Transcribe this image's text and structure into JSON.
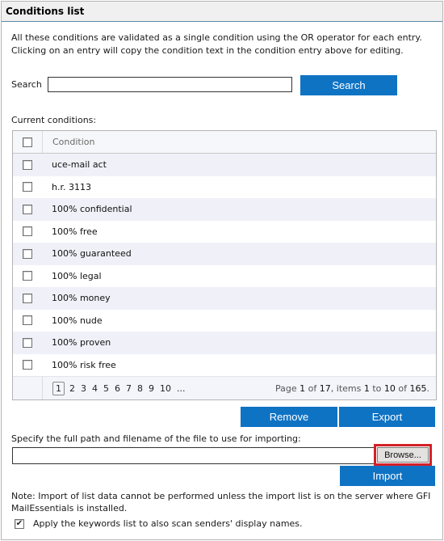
{
  "panel": {
    "title": "Conditions list",
    "intro_line1": "All these conditions are validated as a single condition using the OR operator for each entry.",
    "intro_line2": "Clicking on an entry will copy the condition text in the condition entry above for editing."
  },
  "search": {
    "label": "Search",
    "value": "",
    "placeholder": "",
    "button_label": "Search"
  },
  "conditions": {
    "label": "Current conditions:",
    "column_header": "Condition",
    "rows": [
      {
        "text": "uce-mail act",
        "checked": false
      },
      {
        "text": "h.r. 3113",
        "checked": false
      },
      {
        "text": "100% confidential",
        "checked": false
      },
      {
        "text": "100% free",
        "checked": false
      },
      {
        "text": "100% guaranteed",
        "checked": false
      },
      {
        "text": "100% legal",
        "checked": false
      },
      {
        "text": "100% money",
        "checked": false
      },
      {
        "text": "100% nude",
        "checked": false
      },
      {
        "text": "100% proven",
        "checked": false
      },
      {
        "text": "100% risk free",
        "checked": false
      }
    ],
    "pager": {
      "pages": [
        "1",
        "2",
        "3",
        "4",
        "5",
        "6",
        "7",
        "8",
        "9",
        "10",
        "..."
      ],
      "current_page": "1",
      "info_prefix": "Page ",
      "page": "1",
      "info_of": " of ",
      "total_pages": "17",
      "info_items": ", items ",
      "item_from": "1",
      "info_to": " to ",
      "item_to": "10",
      "info_of2": " of ",
      "total_items": "165",
      "info_end": "."
    }
  },
  "actions": {
    "remove_label": "Remove",
    "export_label": "Export"
  },
  "import": {
    "label": "Specify the full path and filename of the file to use for importing:",
    "file_value": "",
    "browse_label": "Browse...",
    "import_label": "Import",
    "note": "Note: Import of list data cannot be performed unless the import list is on the server where GFI MailEssentials is installed."
  },
  "option": {
    "apply_label": "Apply the keywords list to also scan senders' display names.",
    "apply_checked": true,
    "check_glyph": "✔"
  },
  "colors": {
    "accent_button": "#0f73c4",
    "highlight_border": "#d42027",
    "row_alt": "#f0f1f8"
  }
}
